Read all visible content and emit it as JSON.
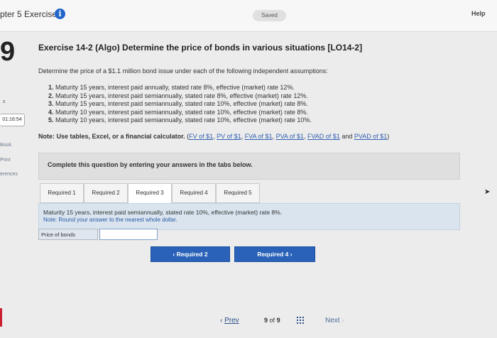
{
  "topbar": {
    "chapter": "pter 5 Exercises",
    "info_glyph": "i",
    "saved": "Saved",
    "help": "Help"
  },
  "left_rail": {
    "question_number": "9",
    "mark": "s",
    "timer": "01:16:54",
    "links": [
      "Book",
      "Print",
      "erences"
    ]
  },
  "exercise": {
    "title": "Exercise 14-2 (Algo) Determine the price of bonds in various situations [LO14-2]",
    "intro": "Determine the price of a $1.1 million bond issue under each of the following independent assumptions:",
    "assumptions": [
      {
        "num": "1.",
        "text": "Maturity 15 years, interest paid annually, stated rate 8%, effective (market) rate 12%."
      },
      {
        "num": "2.",
        "text": "Maturity 15 years, interest paid semiannually, stated rate 8%, effective (market) rate 12%."
      },
      {
        "num": "3.",
        "text": "Maturity 15 years, interest paid semiannually, stated rate 10%, effective (market) rate 8%."
      },
      {
        "num": "4.",
        "text": "Maturity 10 years, interest paid semiannually, stated rate 10%, effective (market) rate 8%."
      },
      {
        "num": "5.",
        "text": "Maturity 10 years, interest paid semiannually, stated rate 10%, effective (market) rate 10%."
      }
    ],
    "note_bold": "Note: Use tables, Excel, or a financial calculator.",
    "note_links": {
      "open": "(",
      "fv": "FV of $1",
      "pv": "PV of $1",
      "fva": "FVA of $1",
      "pva": "PVA of $1",
      "fvad": "FVAD of $1",
      "and": "and",
      "pvad": "PVAD of $1",
      "close": ")",
      "sep": ", "
    }
  },
  "complete_box": {
    "text": "Complete this question by entering your answers in the tabs below."
  },
  "tabs": [
    {
      "label": "Required 1",
      "active": false
    },
    {
      "label": "Required 2",
      "active": false
    },
    {
      "label": "Required 3",
      "active": true
    },
    {
      "label": "Required 4",
      "active": false
    },
    {
      "label": "Required 5",
      "active": false
    }
  ],
  "panel": {
    "line1": "Maturity 15 years, interest paid semiannually, stated rate 10%, effective (market) rate 8%.",
    "line2": "Note: Round your answer to the nearest whole dollar."
  },
  "answer": {
    "label": "Price of bonds",
    "value": ""
  },
  "buttons": {
    "prev_required": "Required 2",
    "next_required": "Required 4"
  },
  "pager": {
    "prev": "Prev",
    "current": "9",
    "of": "of",
    "total": "9",
    "next": "Next"
  },
  "colors": {
    "primary": "#2962b8",
    "panel": "#d9e4ef",
    "alert": "#cc1f2e"
  }
}
